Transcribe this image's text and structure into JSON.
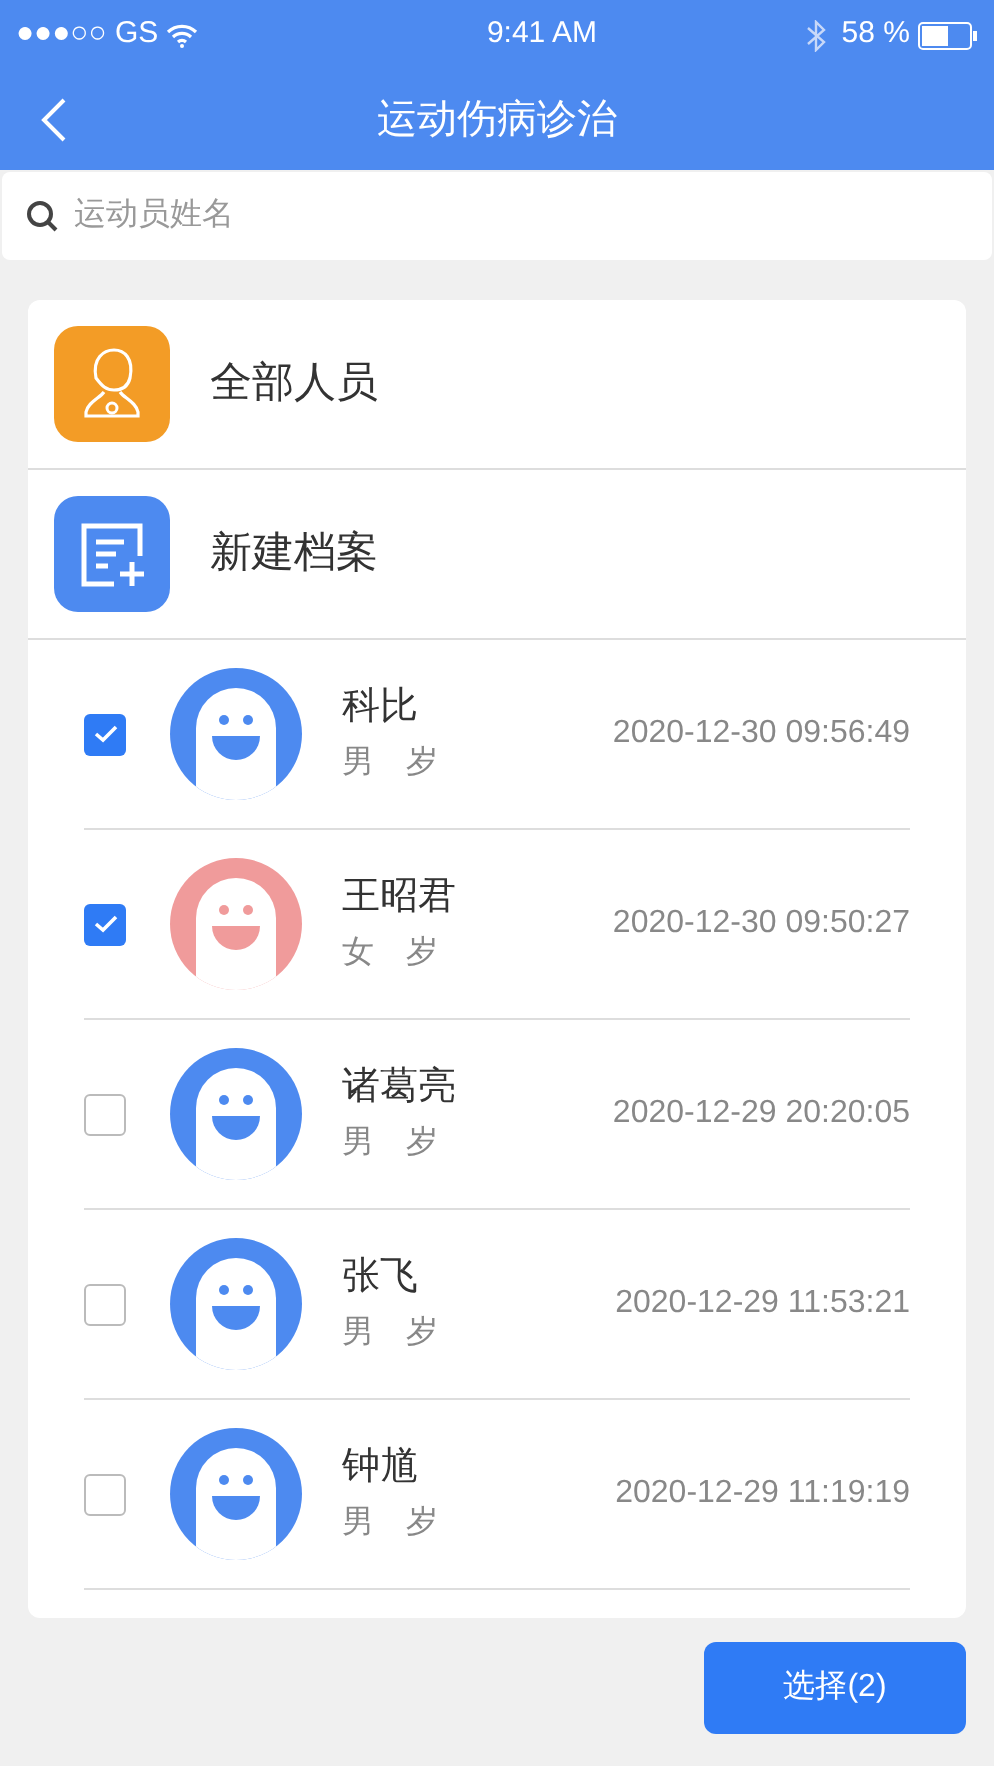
{
  "status_bar": {
    "carrier": "●●●○○ GS",
    "time": "9:41 AM",
    "battery": "58 %"
  },
  "nav": {
    "title": "运动伤病诊治"
  },
  "search": {
    "placeholder": "运动员姓名"
  },
  "menu": [
    {
      "kind": "people",
      "label": "全部人员"
    },
    {
      "kind": "new_record",
      "label": "新建档案"
    }
  ],
  "athletes": [
    {
      "name": "科比",
      "gender": "男",
      "age": "岁",
      "time": "2020-12-30 09:56:49",
      "checked": true,
      "color": "#4d8af0"
    },
    {
      "name": "王昭君",
      "gender": "女",
      "age": "岁",
      "time": "2020-12-30 09:50:27",
      "checked": true,
      "color": "#f09b9b"
    },
    {
      "name": "诸葛亮",
      "gender": "男",
      "age": "岁",
      "time": "2020-12-29 20:20:05",
      "checked": false,
      "color": "#4d8af0"
    },
    {
      "name": "张飞",
      "gender": "男",
      "age": "岁",
      "time": "2020-12-29 11:53:21",
      "checked": false,
      "color": "#4d8af0"
    },
    {
      "name": "钟馗",
      "gender": "男",
      "age": "岁",
      "time": "2020-12-29 11:19:19",
      "checked": false,
      "color": "#4d8af0"
    }
  ],
  "select_button": "选择(2)"
}
